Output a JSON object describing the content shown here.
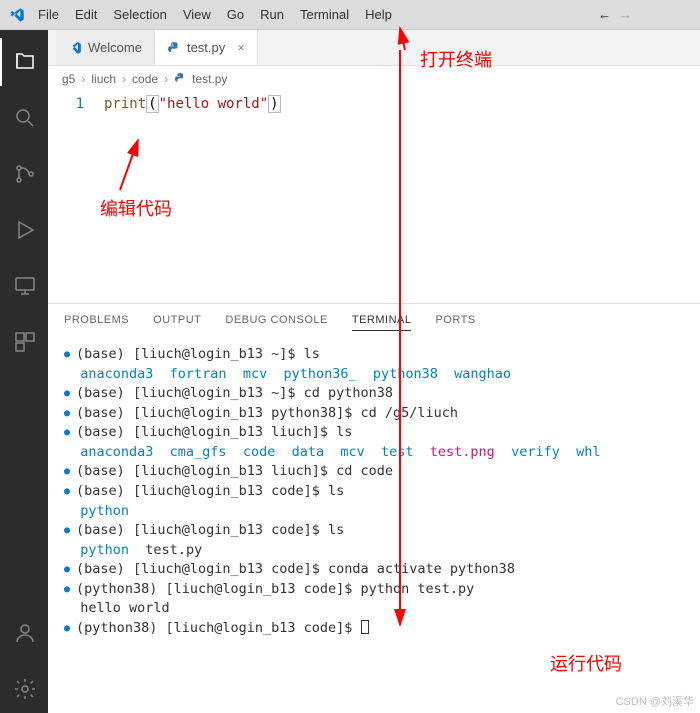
{
  "menubar": [
    "File",
    "Edit",
    "Selection",
    "View",
    "Go",
    "Run",
    "Terminal",
    "Help"
  ],
  "tabs": [
    {
      "icon": "vscode",
      "label": "Welcome",
      "active": false,
      "close": false
    },
    {
      "icon": "python",
      "label": "test.py",
      "active": true,
      "close": true
    }
  ],
  "breadcrumb": [
    "g5",
    "liuch",
    "code",
    "test.py"
  ],
  "code": {
    "line_no": "1",
    "fn": "print",
    "str": "\"hello world\""
  },
  "panel_tabs": [
    "PROBLEMS",
    "OUTPUT",
    "DEBUG CONSOLE",
    "TERMINAL",
    "PORTS"
  ],
  "panel_active": 3,
  "terminal_lines": [
    {
      "bullet": true,
      "segs": [
        {
          "t": "(base) [liuch@login_b13 ~]$ ls"
        }
      ]
    },
    {
      "bullet": false,
      "segs": [
        {
          "t": "anaconda3  fortran  mcv  python36_  python38  wanghao",
          "c": "cyan"
        }
      ]
    },
    {
      "bullet": true,
      "segs": [
        {
          "t": "(base) [liuch@login_b13 ~]$ cd python38"
        }
      ]
    },
    {
      "bullet": true,
      "segs": [
        {
          "t": "(base) [liuch@login_b13 python38]$ cd /g5/liuch"
        }
      ]
    },
    {
      "bullet": true,
      "segs": [
        {
          "t": "(base) [liuch@login_b13 liuch]$ ls"
        }
      ]
    },
    {
      "bullet": false,
      "segs": [
        {
          "t": "anaconda3  cma_gfs  code  data  mcv  test",
          "c": "cyan"
        },
        {
          "t": "  "
        },
        {
          "t": "test.png",
          "c": "magenta"
        },
        {
          "t": "  "
        },
        {
          "t": "verify  whl",
          "c": "cyan"
        }
      ]
    },
    {
      "bullet": true,
      "segs": [
        {
          "t": "(base) [liuch@login_b13 liuch]$ cd code"
        }
      ]
    },
    {
      "bullet": true,
      "segs": [
        {
          "t": "(base) [liuch@login_b13 code]$ ls"
        }
      ]
    },
    {
      "bullet": false,
      "segs": [
        {
          "t": "python",
          "c": "cyan"
        }
      ]
    },
    {
      "bullet": true,
      "segs": [
        {
          "t": "(base) [liuch@login_b13 code]$ ls"
        }
      ]
    },
    {
      "bullet": false,
      "segs": [
        {
          "t": "python",
          "c": "cyan"
        },
        {
          "t": "  test.py"
        }
      ]
    },
    {
      "bullet": true,
      "segs": [
        {
          "t": "(base) [liuch@login_b13 code]$ conda activate python38"
        }
      ]
    },
    {
      "bullet": true,
      "segs": [
        {
          "t": "(python38) [liuch@login_b13 code]$ python test.py"
        }
      ]
    },
    {
      "bullet": false,
      "segs": [
        {
          "t": "hello world"
        }
      ]
    },
    {
      "bullet": true,
      "segs": [
        {
          "t": "(python38) [liuch@login_b13 code]$ "
        }
      ],
      "cursor": true
    }
  ],
  "annotations": {
    "open_terminal": "打开终端",
    "edit_code": "编辑代码",
    "run_code": "运行代码"
  },
  "watermark": "CSDN @刘溪华"
}
